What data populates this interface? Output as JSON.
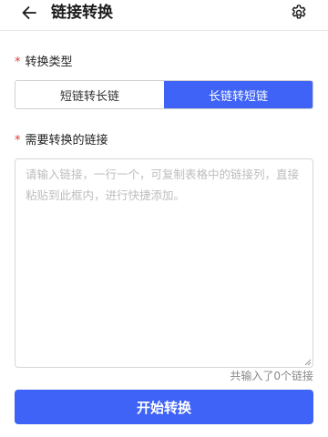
{
  "header": {
    "title": "链接转换",
    "back_icon": "arrow-left-icon",
    "settings_icon": "gear-icon"
  },
  "conversion_type": {
    "required_mark": "*",
    "label": "转换类型",
    "options": [
      "短链转长链",
      "长链转短链"
    ],
    "selected": "长链转短链"
  },
  "links_input": {
    "required_mark": "*",
    "label": "需要转换的链接",
    "value": "",
    "placeholder": "请输入链接，一行一个，可复制表格中的链接列，直接粘贴到此框内，进行快捷添加。",
    "counter_text": "共输入了0个链接"
  },
  "actions": {
    "start_label": "开始转换"
  },
  "colors": {
    "accent": "#3f63f6",
    "required": "#e8362d"
  }
}
